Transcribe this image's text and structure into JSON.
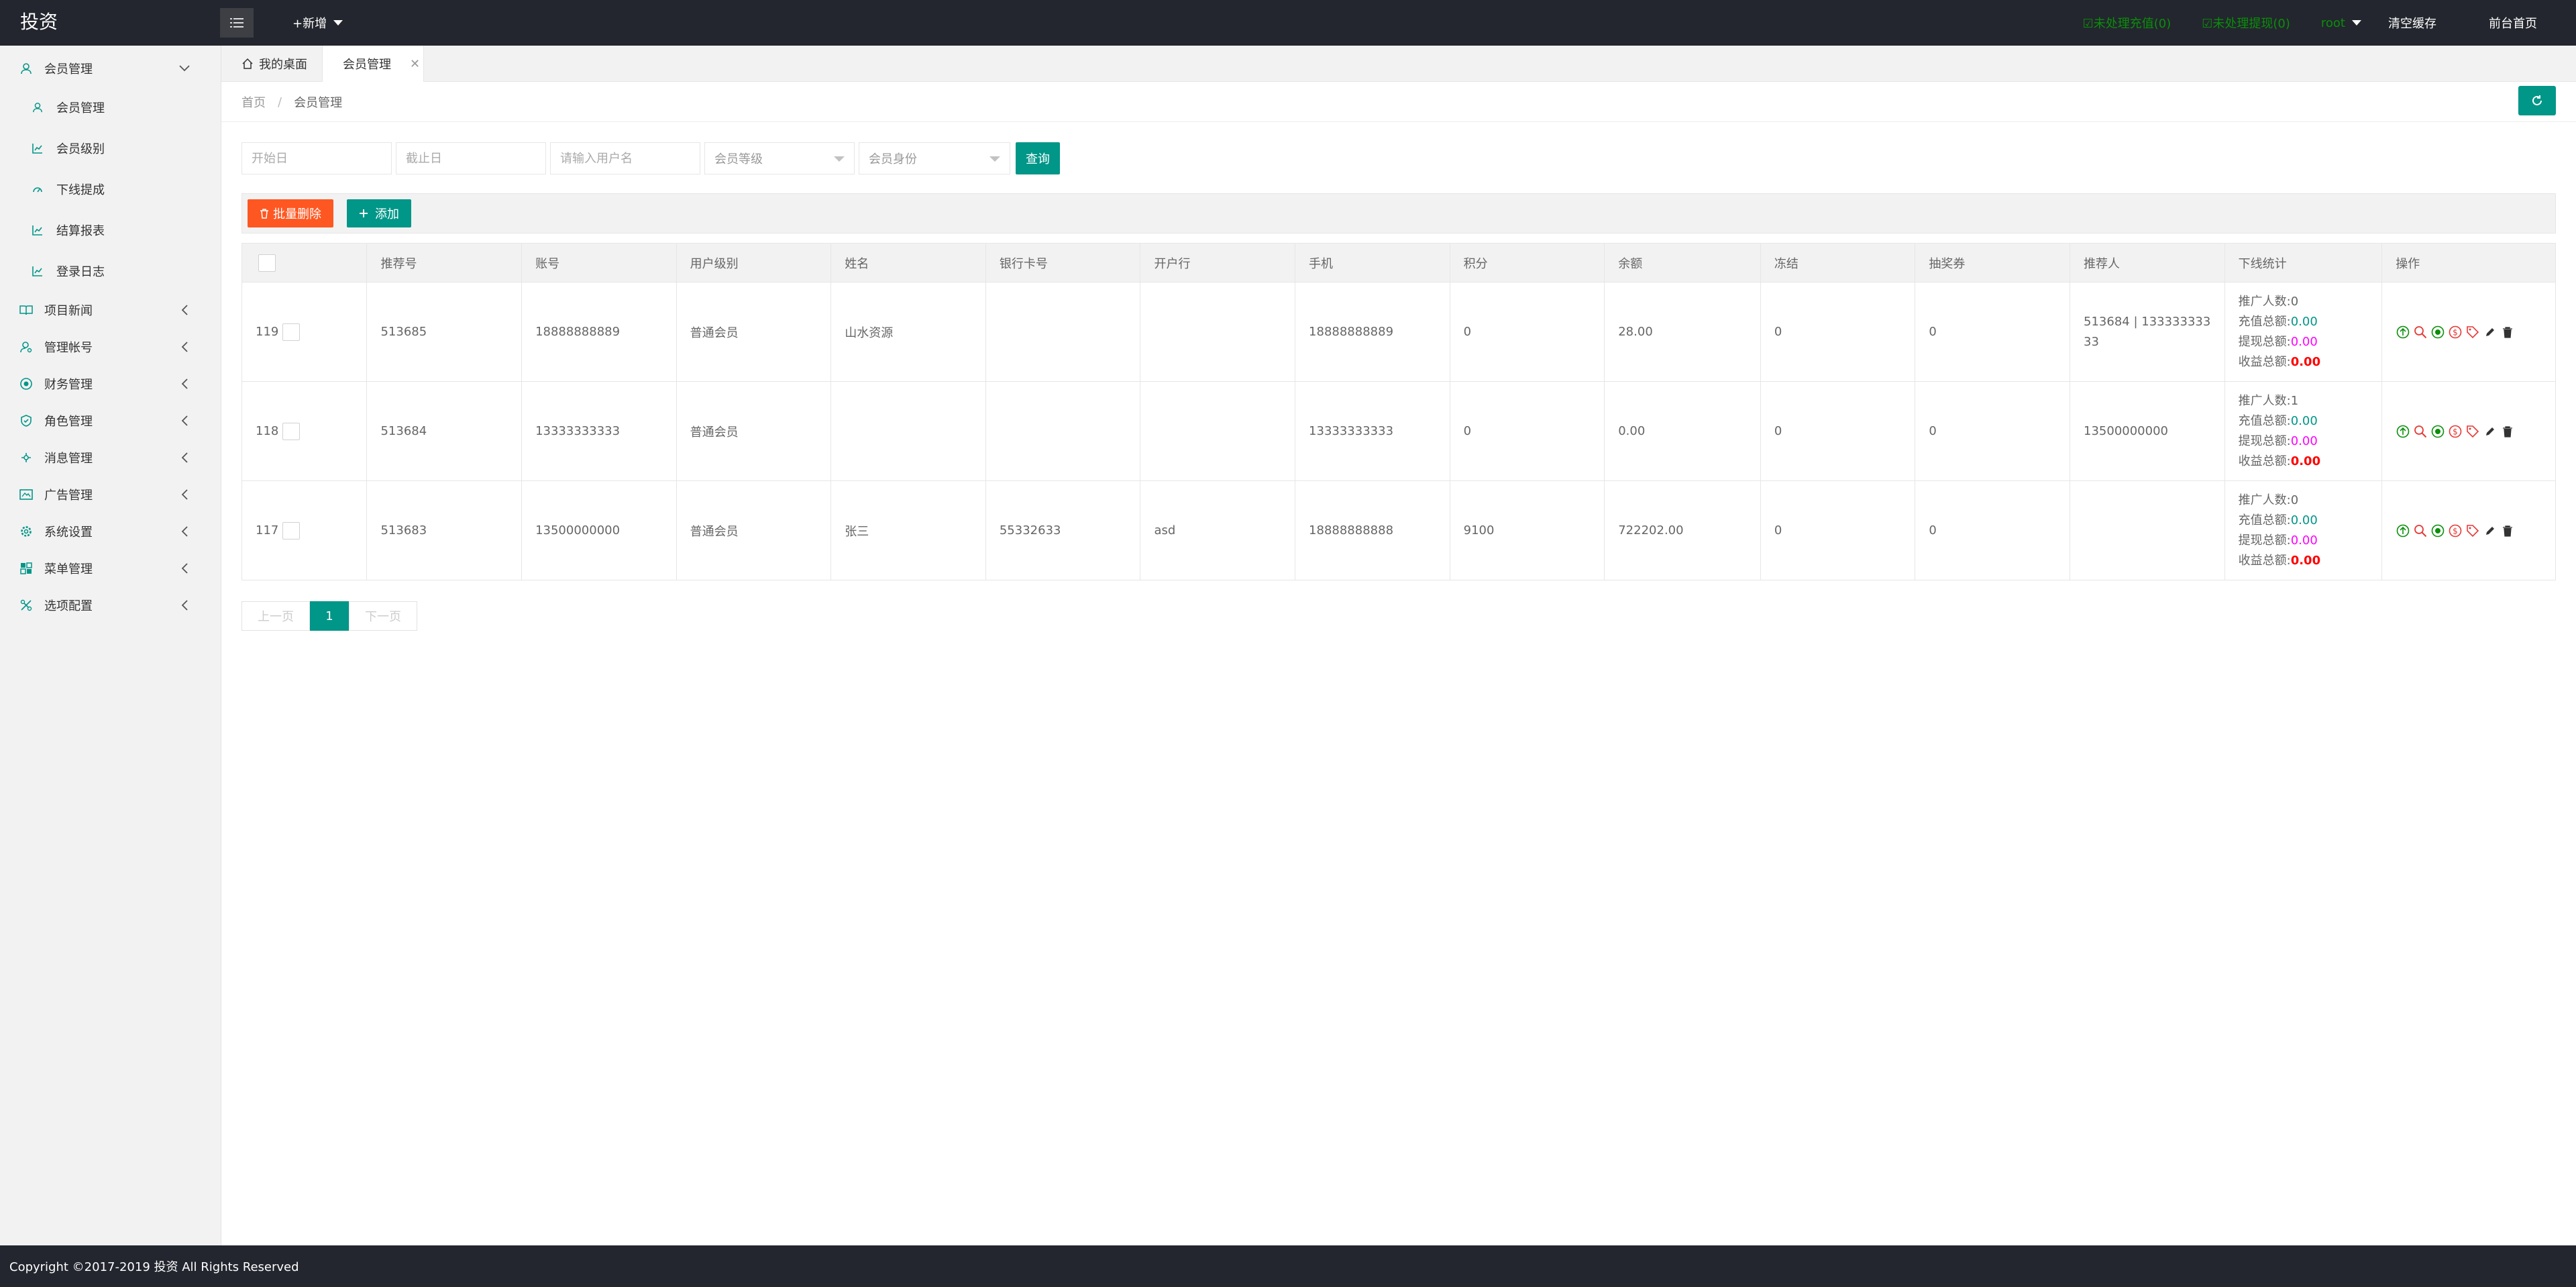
{
  "app": {
    "logo": "投资"
  },
  "topbar": {
    "new_label": "+新增",
    "pending_recharge": "☑未处理充值(0)",
    "pending_withdraw": "☑未处理提现(0)",
    "user": "root",
    "clear_cache": "清空缓存",
    "front_home": "前台首页"
  },
  "sidebar": {
    "groups": [
      {
        "label": "会员管理",
        "icon": "user-icon"
      },
      {
        "label": "项目新闻",
        "icon": "book-icon"
      },
      {
        "label": "管理帐号",
        "icon": "admin-icon"
      },
      {
        "label": "财务管理",
        "icon": "finance-icon"
      },
      {
        "label": "角色管理",
        "icon": "shield-icon"
      },
      {
        "label": "消息管理",
        "icon": "message-icon"
      },
      {
        "label": "广告管理",
        "icon": "ad-icon"
      },
      {
        "label": "系统设置",
        "icon": "gear-icon"
      },
      {
        "label": "菜单管理",
        "icon": "menu-icon"
      },
      {
        "label": "选项配置",
        "icon": "options-icon"
      }
    ],
    "subitems": [
      {
        "label": "会员管理"
      },
      {
        "label": "会员级别"
      },
      {
        "label": "下线提成"
      },
      {
        "label": "结算报表"
      },
      {
        "label": "登录日志"
      }
    ]
  },
  "tabs": {
    "home": "我的桌面",
    "current": "会员管理",
    "close": "✕"
  },
  "breadcrumb": {
    "home": "首页",
    "sep": "/",
    "current": "会员管理"
  },
  "filters": {
    "start_placeholder": "开始日",
    "end_placeholder": "截止日",
    "username_placeholder": "请输入用户名",
    "level_select": "会员等级",
    "identity_select": "会员身份",
    "query_label": "查询"
  },
  "toolbar": {
    "batch_delete": "批量删除",
    "add": "添加"
  },
  "table": {
    "headers": [
      "推荐号",
      "账号",
      "用户级别",
      "姓名",
      "银行卡号",
      "开户行",
      "手机",
      "积分",
      "余额",
      "冻结",
      "抽奖券",
      "推荐人",
      "下线统计",
      "操作"
    ],
    "stat_labels": {
      "promote": "推广人数:",
      "recharge": "充值总额:",
      "withdraw": "提现总额:",
      "income": "收益总额:"
    },
    "rows": [
      {
        "id": "119",
        "code": "513685",
        "account": "18888888889",
        "level": "普通会员",
        "name": "山水资源",
        "bank_card": "",
        "bank": "",
        "phone": "18888888889",
        "points": "0",
        "balance": "28.00",
        "frozen": "0",
        "lottery": "0",
        "referrer": "513684 | 13333333333",
        "promote": "0",
        "recharge": "0.00",
        "withdraw": "0.00",
        "income": "0.00"
      },
      {
        "id": "118",
        "code": "513684",
        "account": "13333333333",
        "level": "普通会员",
        "name": "",
        "bank_card": "",
        "bank": "",
        "phone": "13333333333",
        "points": "0",
        "balance": "0.00",
        "frozen": "0",
        "lottery": "0",
        "referrer": "13500000000",
        "promote": "1",
        "recharge": "0.00",
        "withdraw": "0.00",
        "income": "0.00"
      },
      {
        "id": "117",
        "code": "513683",
        "account": "13500000000",
        "level": "普通会员",
        "name": "张三",
        "bank_card": "55332633",
        "bank": "asd",
        "phone": "18888888888",
        "points": "9100",
        "balance": "722202.00",
        "frozen": "0",
        "lottery": "0",
        "referrer": "",
        "promote": "0",
        "recharge": "0.00",
        "withdraw": "0.00",
        "income": "0.00"
      }
    ]
  },
  "pagination": {
    "prev": "上一页",
    "current": "1",
    "next": "下一页"
  },
  "footer": {
    "copyright": "Copyright ©2017-2019 投资 All Rights Reserved"
  },
  "colors": {
    "topbar": "#23262e",
    "accent": "#009688",
    "danger": "#ff5722",
    "sidebar": "#f2f2f2"
  }
}
